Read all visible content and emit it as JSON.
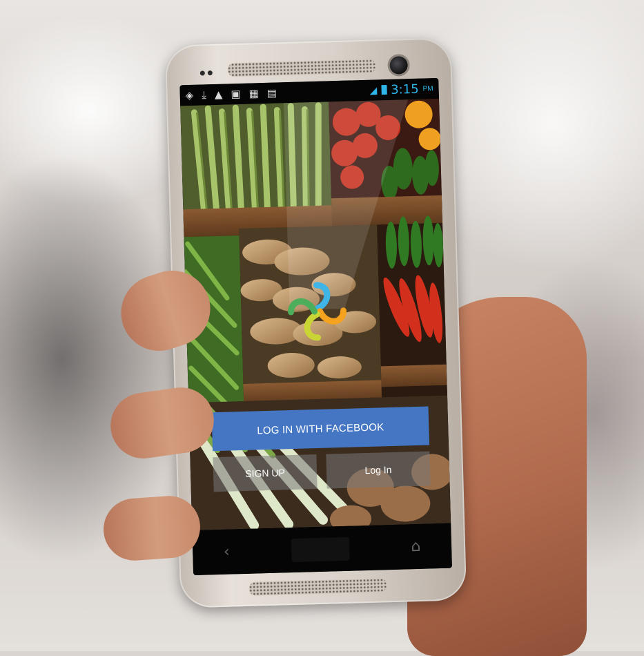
{
  "status_bar": {
    "notification_icons": [
      "location-icon",
      "download-icon",
      "warning-icon",
      "image-icon",
      "calendar-icon",
      "briefcase-icon"
    ],
    "time": "3:15",
    "ampm": "PM"
  },
  "login": {
    "facebook_label": "LOG IN WITH FACEBOOK",
    "signup_label": "SIGN UP",
    "login_label": "Log In"
  },
  "colors": {
    "facebook_blue": "#4476c4",
    "clock_blue": "#2fb5e9",
    "logo_blue": "#3fb4e6",
    "logo_orange": "#f5a21f",
    "logo_green": "#4cae5b",
    "logo_yellow": "#c9d535"
  }
}
